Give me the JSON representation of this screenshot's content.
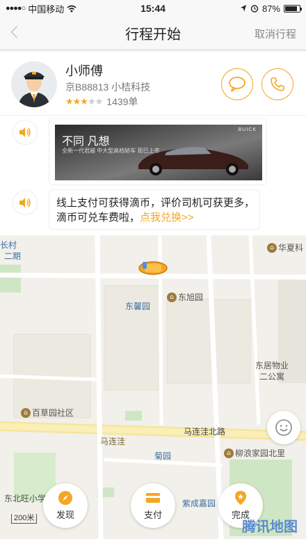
{
  "status_bar": {
    "carrier": "中国移动",
    "time": "15:44",
    "battery": "87%",
    "battery_level": 0.87
  },
  "nav": {
    "title": "行程开始",
    "cancel": "取消行程"
  },
  "driver": {
    "name": "小师傅",
    "plate_company": "京B88813 小桔科技",
    "rating_stars": 3,
    "orders": "1439单"
  },
  "ad": {
    "headline": "不同 凡想",
    "tagline": "全新一代君越 中大型高档轿车 现已上市",
    "brand": "BUICK"
  },
  "promo": {
    "text": "线上支付可获得滴币，评价司机可获更多，滴币可兑车费啦，",
    "link": "点我兑换>>"
  },
  "map": {
    "labels": [
      "东馨园",
      "东旭园",
      "百草园社区",
      "马连洼北路",
      "马连洼",
      "菊园",
      "柳浪家园北里",
      "紫成嘉园",
      "东居物业二公寓",
      "华夏科",
      "长村",
      "二期",
      "东北旺小学"
    ]
  },
  "actions": {
    "discover": "发现",
    "pay": "支付",
    "complete": "完成"
  },
  "scale": "200米",
  "map_logo": "腾讯地图"
}
